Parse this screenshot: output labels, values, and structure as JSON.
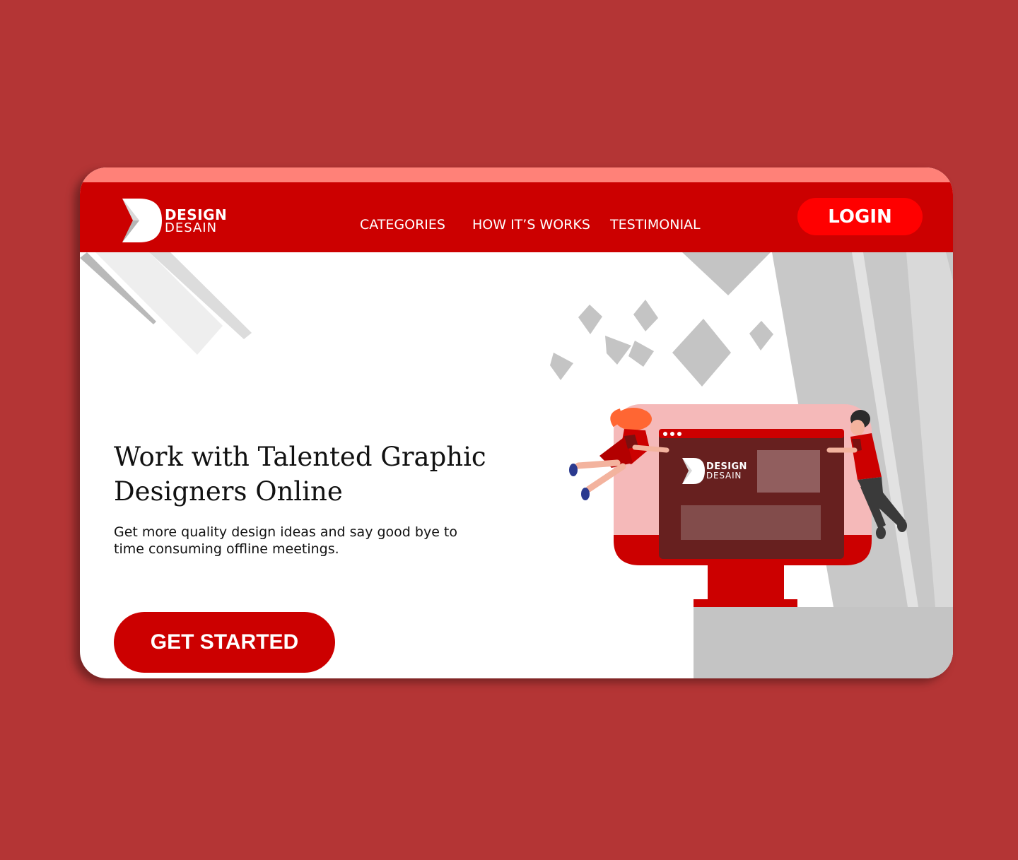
{
  "colors": {
    "page_background": "#b43535",
    "brand_red": "#cc0000",
    "login_button": "#ff0000",
    "top_strip": "#ff8178",
    "card_background": "#ffffff",
    "decor_gray": "#c4c4c4"
  },
  "brand": {
    "logo_icon": "d-monogram-logo-icon",
    "line1": "DESIGN",
    "line2": "DESAIN"
  },
  "nav": {
    "items": [
      {
        "label": "CATEGORIES"
      },
      {
        "label": "HOW IT’S WORKS"
      },
      {
        "label": "TESTIMONIAL"
      }
    ],
    "login_label": "LOGIN"
  },
  "hero": {
    "title_line1": "Work with Talented Graphic",
    "title_line2": "Designers Online",
    "subtitle_line1": "Get more quality design ideas and say good bye to",
    "subtitle_line2": "time consuming offline meetings.",
    "cta_label": "GET STARTED"
  },
  "illustration": {
    "brand_line1": "DESIGN",
    "brand_line2": "DESAIN",
    "icons": [
      "monitor-icon",
      "woman-figure-icon",
      "man-figure-icon",
      "window-dots-icon"
    ]
  }
}
